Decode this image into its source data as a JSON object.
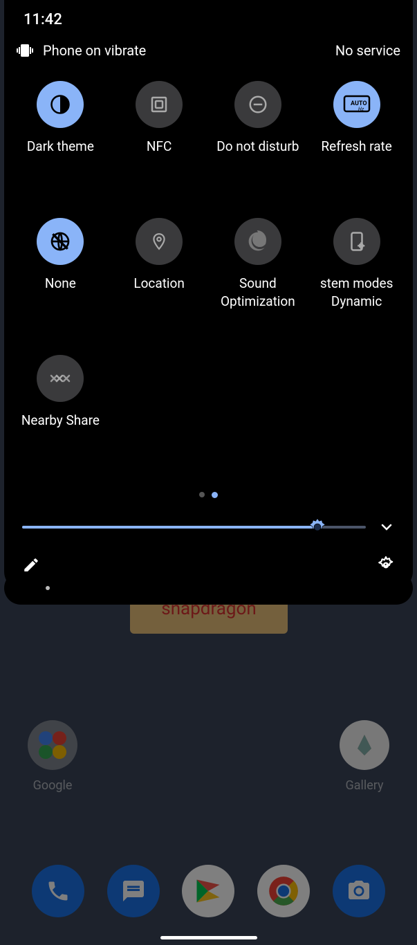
{
  "status": {
    "clock": "11:42",
    "vibrate_text": "Phone on vibrate",
    "network": "No service"
  },
  "tiles": [
    {
      "name": "dark-theme",
      "label": "Dark theme",
      "active": true,
      "icon": "half-circle"
    },
    {
      "name": "nfc",
      "label": "NFC",
      "active": false,
      "icon": "nfc"
    },
    {
      "name": "dnd",
      "label": "Do not disturb",
      "active": false,
      "icon": "dnd"
    },
    {
      "name": "refresh-rate",
      "label": "Refresh rate",
      "active": true,
      "icon": "auto-hz"
    },
    {
      "name": "none",
      "label": "None",
      "active": true,
      "icon": "globe-off"
    },
    {
      "name": "location",
      "label": "Location",
      "active": false,
      "icon": "pin"
    },
    {
      "name": "sound-opt",
      "label": "Sound Optimization",
      "active": false,
      "icon": "swirl"
    },
    {
      "name": "system-modes",
      "label": "stem modes Dynamic",
      "active": false,
      "icon": "phone-gear"
    },
    {
      "name": "nearby-share",
      "label": "Nearby Share",
      "active": false,
      "icon": "nearby"
    }
  ],
  "page_indicator": {
    "total": 2,
    "current": 1
  },
  "brightness": {
    "percent": 86
  },
  "home": {
    "widget": "snapdragon",
    "apps": [
      {
        "name": "google",
        "label": "Google"
      },
      {
        "name": "gallery",
        "label": "Gallery"
      }
    ]
  }
}
